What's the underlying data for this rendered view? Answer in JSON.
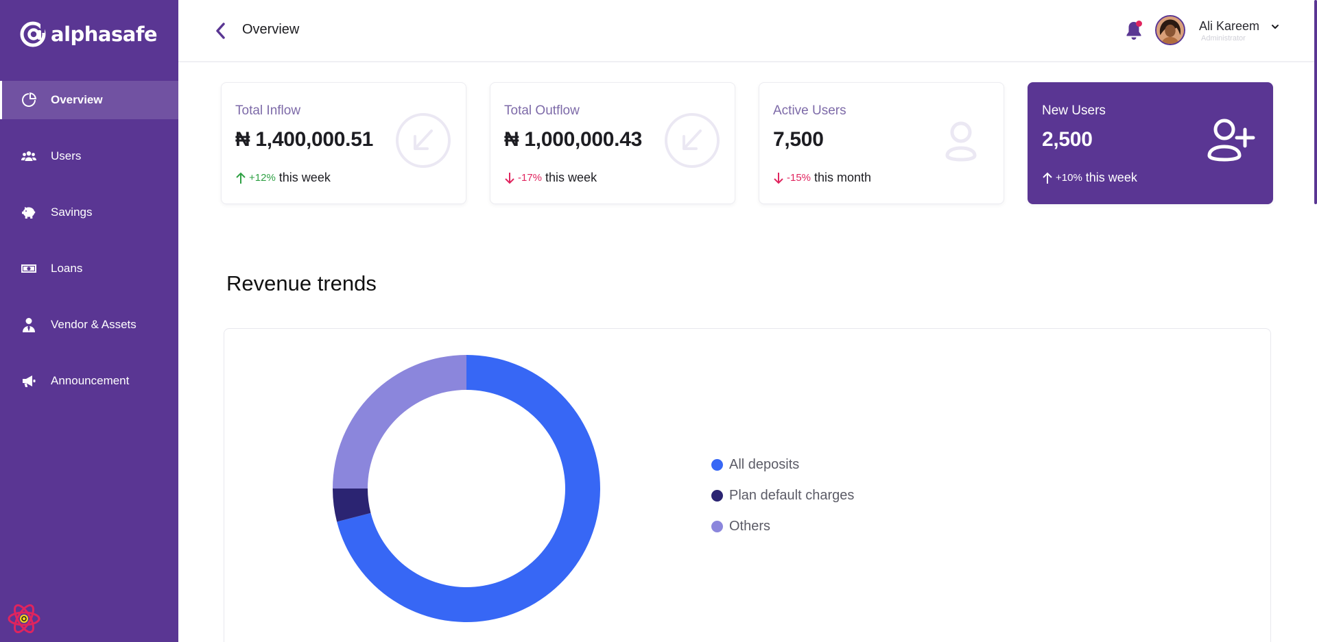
{
  "brand": {
    "name": "alphasafe"
  },
  "sidebar": {
    "items": [
      {
        "label": "Overview",
        "icon": "chart-pie-icon",
        "active": true
      },
      {
        "label": "Users",
        "icon": "users-icon",
        "active": false
      },
      {
        "label": "Savings",
        "icon": "piggy-bank-icon",
        "active": false
      },
      {
        "label": "Loans",
        "icon": "money-bill-icon",
        "active": false
      },
      {
        "label": "Vendor & Assets",
        "icon": "user-tie-icon",
        "active": false
      },
      {
        "label": "Announcement",
        "icon": "megaphone-icon",
        "active": false
      }
    ]
  },
  "header": {
    "title": "Overview",
    "user": {
      "name": "Ali Kareem",
      "role": "Administrator"
    },
    "has_notification": true
  },
  "stats": [
    {
      "title": "Total Inflow",
      "value": "₦ 1,400,000.51",
      "trend_direction": "up",
      "trend_pct": "+12%",
      "trend_period": "this week",
      "icon": "arrow-down-left-circle-icon"
    },
    {
      "title": "Total Outflow",
      "value": "₦ 1,000,000.43",
      "trend_direction": "down",
      "trend_pct": "-17%",
      "trend_period": "this week",
      "icon": "arrow-down-left-circle-icon"
    },
    {
      "title": "Active Users",
      "value": "7,500",
      "trend_direction": "down",
      "trend_pct": "-15%",
      "trend_period": "this month",
      "icon": "user-icon"
    },
    {
      "title": "New Users",
      "value": "2,500",
      "trend_direction": "up",
      "trend_pct": "+10%",
      "trend_period": "this week",
      "icon": "user-plus-icon",
      "highlight": true
    }
  ],
  "revenue": {
    "title": "Revenue trends"
  },
  "chart_data": {
    "type": "pie",
    "title": "Revenue trends",
    "categories": [
      "All deposits",
      "Plan default charges",
      "Others"
    ],
    "values": [
      71,
      4,
      25
    ],
    "colors": [
      "#3767f5",
      "#2b2472",
      "#8b86dc"
    ],
    "legend_position": "right"
  },
  "colors": {
    "brand_purple": "#5a3693",
    "positive": "#2ea043",
    "negative": "#e0245e"
  }
}
